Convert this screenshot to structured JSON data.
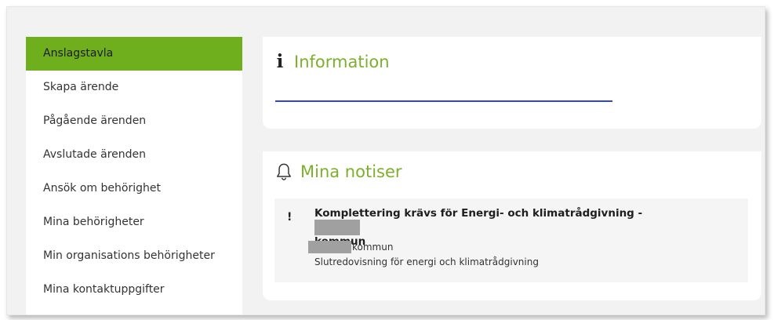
{
  "sidebar": {
    "items": [
      {
        "label": "Anslagstavla",
        "active": true
      },
      {
        "label": "Skapa ärende",
        "active": false
      },
      {
        "label": "Pågående ärenden",
        "active": false
      },
      {
        "label": "Avslutade ärenden",
        "active": false
      },
      {
        "label": "Ansök om behörighet",
        "active": false
      },
      {
        "label": "Mina behörigheter",
        "active": false
      },
      {
        "label": "Min organisations behörigheter",
        "active": false
      },
      {
        "label": "Mina kontaktuppgifter",
        "active": false
      }
    ]
  },
  "information": {
    "icon": "info-icon",
    "title": "Information"
  },
  "notices": {
    "icon": "bell-icon",
    "title": "Mina notiser",
    "items": [
      {
        "icon": "exclamation-icon",
        "title_prefix": "Komplettering krävs för Energi- och klimatrådgivning -",
        "title_suffix": "kommun",
        "org_suffix": "kommun",
        "subtitle": "Slutredovisning för energi och klimatrådgivning"
      }
    ]
  },
  "colors": {
    "accent_green": "#6fae1d",
    "title_green": "#7cb02c",
    "underline_blue": "#34499c",
    "background": "#f2f2f2",
    "redaction": "#a0a0a0"
  }
}
